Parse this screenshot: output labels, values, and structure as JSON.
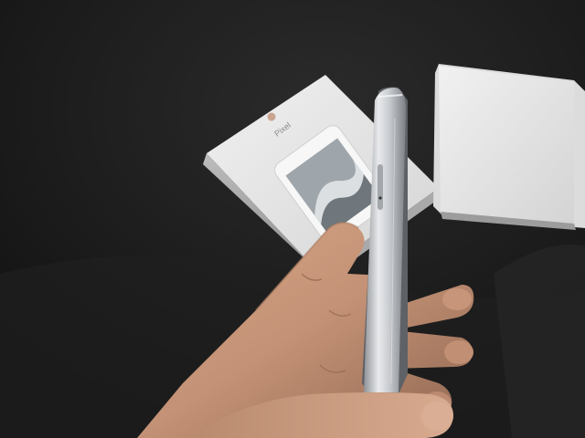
{
  "photo": {
    "subject": "phone-side-profile-in-hand",
    "background_color": "#1b1b1b",
    "box_color": "#e6e6e6",
    "phone_frame_color": "#c9ccd0",
    "skin_color": "#c79678"
  },
  "box_front": {
    "logo_icon": "google-g-icon",
    "title": "Pixel"
  }
}
